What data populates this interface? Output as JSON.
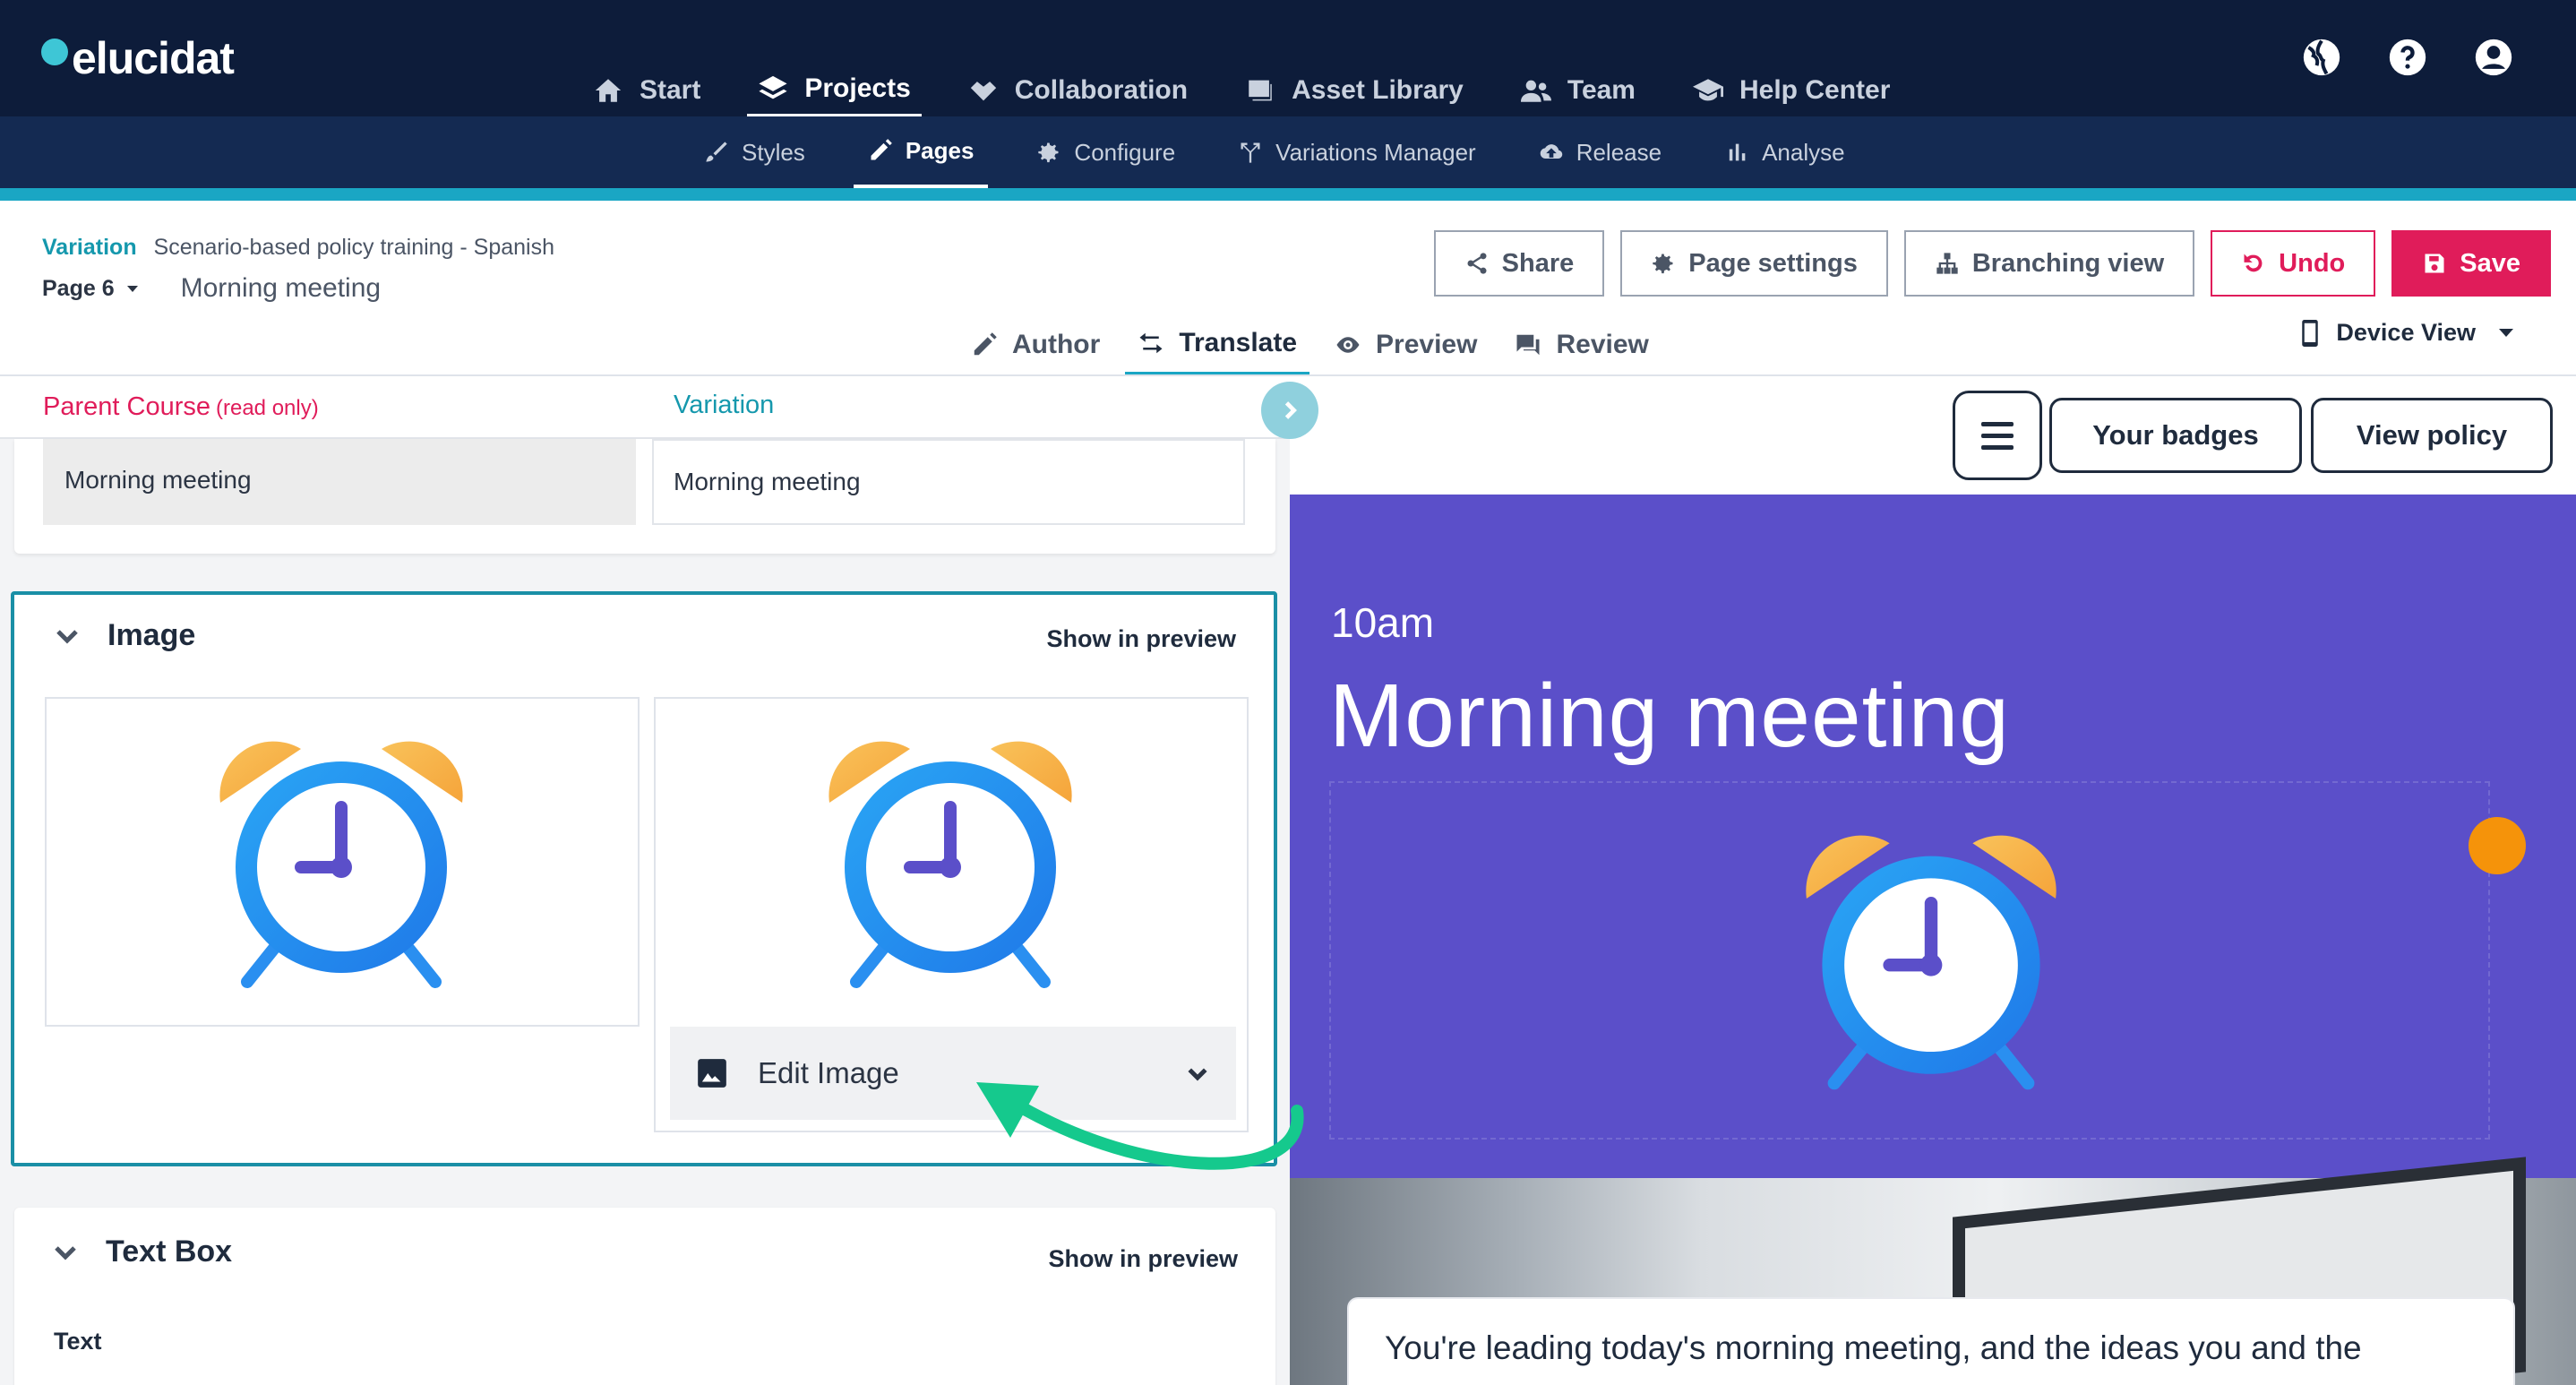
{
  "app": {
    "logo_text": "elucidat"
  },
  "topnav": {
    "items": [
      {
        "label": "Start",
        "icon": "home-icon"
      },
      {
        "label": "Projects",
        "icon": "layers-icon",
        "active": true
      },
      {
        "label": "Collaboration",
        "icon": "handshake-icon"
      },
      {
        "label": "Asset Library",
        "icon": "images-icon"
      },
      {
        "label": "Team",
        "icon": "users-icon"
      },
      {
        "label": "Help Center",
        "icon": "graduation-cap-icon"
      }
    ],
    "right_icons": [
      "globe-icon",
      "help-icon",
      "account-icon"
    ]
  },
  "subnav": {
    "items": [
      {
        "label": "Styles",
        "icon": "brush-icon"
      },
      {
        "label": "Pages",
        "icon": "pencil-icon",
        "active": true
      },
      {
        "label": "Configure",
        "icon": "gear-icon"
      },
      {
        "label": "Variations Manager",
        "icon": "branch-icon"
      },
      {
        "label": "Release",
        "icon": "cloud-upload-icon"
      },
      {
        "label": "Analyse",
        "icon": "bar-chart-icon"
      }
    ]
  },
  "header": {
    "variation_label": "Variation",
    "course_name": "Scenario-based policy training - Spanish",
    "page_label": "Page 6",
    "page_name": "Morning meeting"
  },
  "actions": {
    "share": "Share",
    "page_settings": "Page settings",
    "branching_view": "Branching view",
    "undo": "Undo",
    "save": "Save"
  },
  "modetabs": {
    "author": "Author",
    "translate": "Translate",
    "preview": "Preview",
    "review": "Review",
    "active": "Translate"
  },
  "device_view": "Device View",
  "editor": {
    "parent_course_label": "Parent Course",
    "read_only_label": "(read only)",
    "variation_label": "Variation",
    "title_parent_value": "Morning meeting",
    "title_variation_value": "Morning meeting",
    "image_section": {
      "title": "Image",
      "show_in_preview": "Show in preview",
      "edit_image_label": "Edit Image"
    },
    "textbox_section": {
      "title": "Text Box",
      "show_in_preview": "Show in preview",
      "field_label": "Text"
    }
  },
  "preview": {
    "badges_button": "Your badges",
    "policy_button": "View policy",
    "time": "10am",
    "title": "Morning meeting",
    "body_text": "You're leading today's morning meeting, and the ideas you and the"
  },
  "colors": {
    "nav_bg": "#0d1c3a",
    "subnav_bg": "#142a52",
    "accent_teal": "#1aa6c4",
    "danger_pink": "#e01c5a",
    "preview_purple": "#5b4fc9",
    "arrow_green": "#15c98d"
  }
}
